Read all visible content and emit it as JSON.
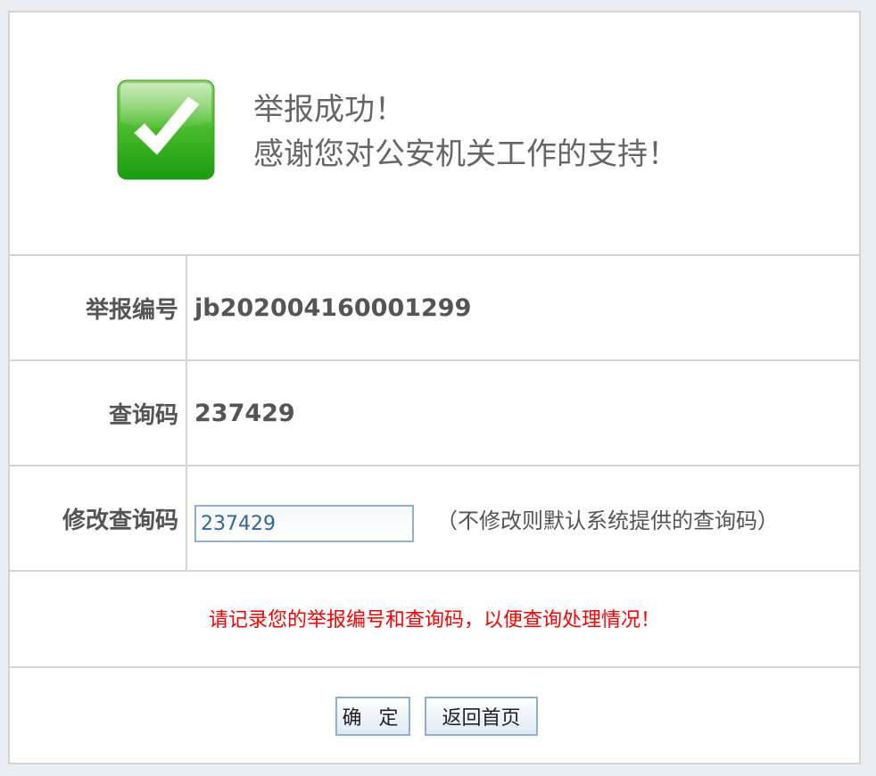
{
  "success": {
    "title": "举报成功！",
    "message": "感谢您对公安机关工作的支持！"
  },
  "report_number": {
    "label": "举报编号",
    "value": "jb202004160001299"
  },
  "query_code": {
    "label": "查询码",
    "value": "237429"
  },
  "modify_query_code": {
    "label": "修改查询码",
    "input_value": "237429",
    "hint": "（不修改则默认系统提供的查询码）"
  },
  "notice": "请记录您的举报编号和查询码，以便查询处理情况！",
  "buttons": {
    "confirm_label": "确 定",
    "home_label": "返回首页"
  },
  "colors": {
    "notice": "#ff0000",
    "icon_green": "#3cb82a",
    "border": "#d6d4d0"
  },
  "icons": {
    "success": "checkmark-icon"
  }
}
